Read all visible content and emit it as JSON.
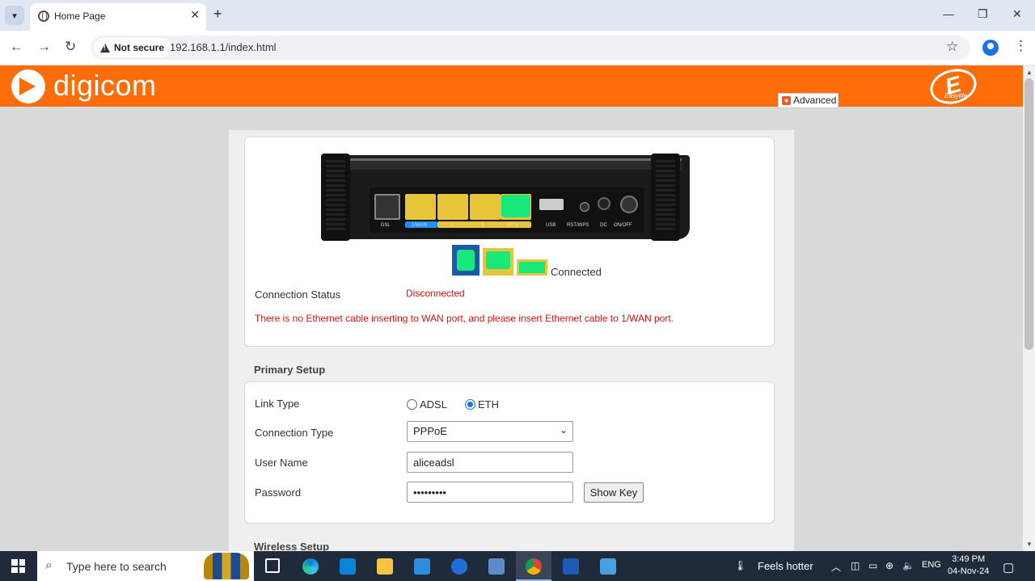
{
  "browser": {
    "tab_title": "Home Page",
    "security_label": "Not secure",
    "url": "192.168.1.1/index.html"
  },
  "header": {
    "brand": "digicom",
    "easy_letter": "E",
    "easy_sub": "Easylife"
  },
  "advanced_label": "Advanced",
  "status": {
    "diagram_labels": [
      "DSL",
      "1/WAN",
      "2",
      "3",
      "4/ITV",
      "USB",
      "RST/WPS",
      "DC",
      "ON/OFF"
    ],
    "legend_label": "Connected",
    "connection_status_label": "Connection Status",
    "connection_status_value": "Disconnected",
    "message": "There is no Ethernet cable inserting to WAN port, and please insert Ethernet cable to 1/WAN port."
  },
  "primary_setup": {
    "title": "Primary Setup",
    "link_type_label": "Link Type",
    "link_options": [
      "ADSL",
      "ETH"
    ],
    "link_selected": "ETH",
    "connection_type_label": "Connection Type",
    "connection_type_value": "PPPoE",
    "user_name_label": "User Name",
    "user_name_value": "aliceadsl",
    "password_label": "Password",
    "password_value": "•••••••••",
    "show_key_label": "Show Key"
  },
  "wireless_setup": {
    "title": "Wireless Setup"
  },
  "taskbar": {
    "search_placeholder": "Type here to search",
    "weather": "Feels hotter",
    "language": "ENG",
    "time": "3:49 PM",
    "date": "04-Nov-24"
  }
}
